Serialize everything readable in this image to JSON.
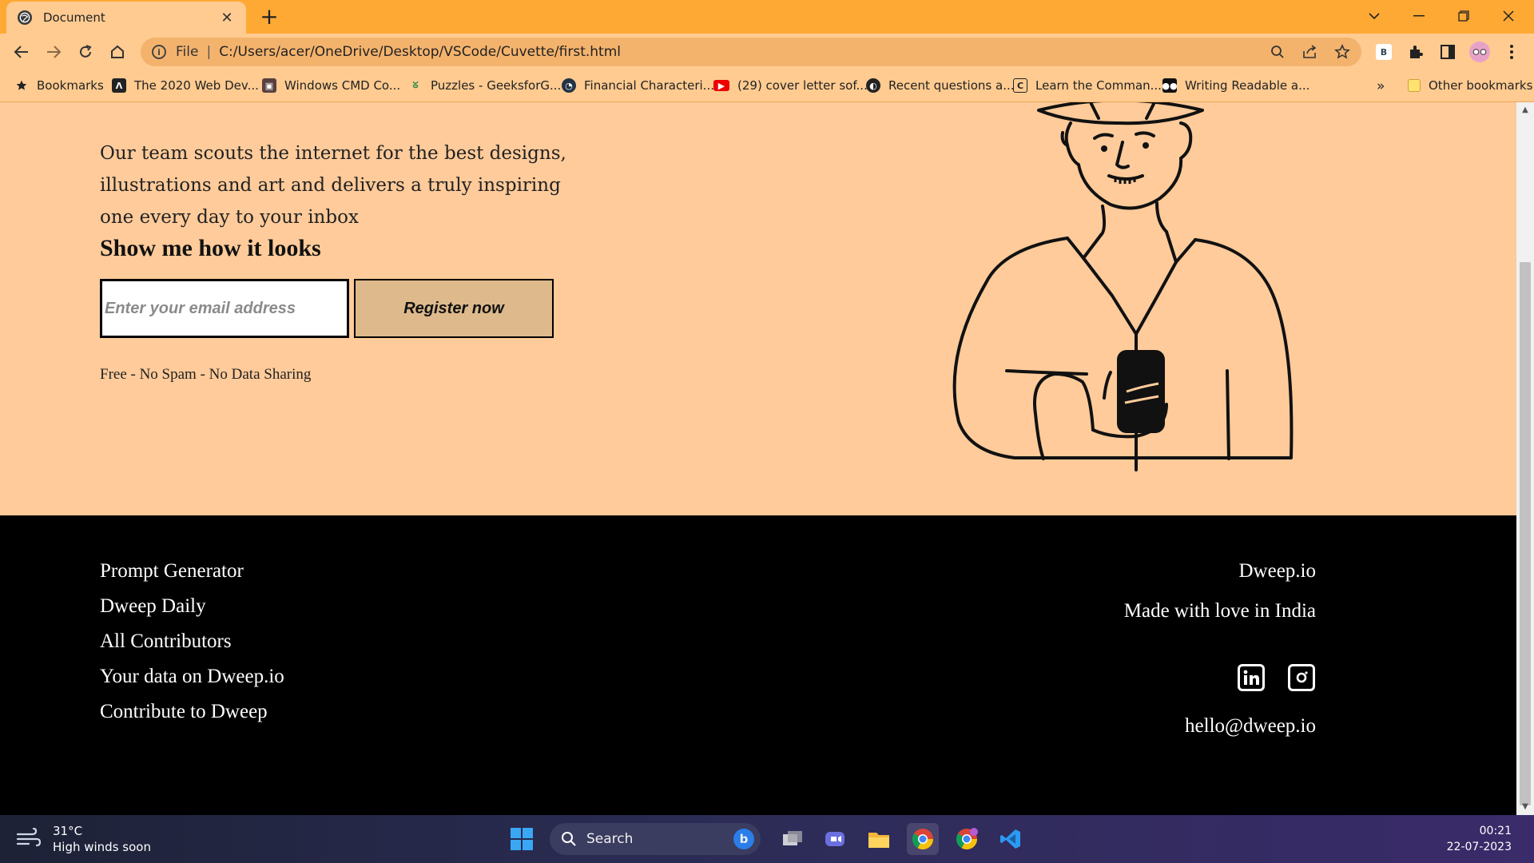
{
  "browser": {
    "tab_title": "Document",
    "tab_close": "✕",
    "new_tab": "+",
    "address_scheme": "File",
    "address_separator": "|",
    "address_url": "C:/Users/acer/OneDrive/Desktop/VSCode/Cuvette/first.html",
    "extension_badge": "B"
  },
  "bookmarks": {
    "items": [
      {
        "label": "Bookmarks",
        "icon": "star-icon"
      },
      {
        "label": "The 2020 Web Dev...",
        "icon": "udemy-icon"
      },
      {
        "label": "Windows CMD Co...",
        "icon": "cmd-icon"
      },
      {
        "label": "Puzzles - GeeksforG...",
        "icon": "geeksforgeeks-icon"
      },
      {
        "label": "Financial Characteri...",
        "icon": "site-icon"
      },
      {
        "label": "(29) cover letter sof...",
        "icon": "youtube-icon"
      },
      {
        "label": "Recent questions a...",
        "icon": "site-icon"
      },
      {
        "label": "Learn the Comman...",
        "icon": "codecademy-icon"
      },
      {
        "label": "Writing Readable a...",
        "icon": "medium-icon"
      }
    ],
    "overflow": "»",
    "other": "Other bookmarks"
  },
  "hero": {
    "description": "Our team scouts the internet for the best designs, illustrations and art and delivers a truly inspiring one every day to your inbox",
    "heading": "Show me how it looks",
    "email_placeholder": "Enter your email address",
    "register_label": "Register now",
    "note": "Free - No Spam - No Data Sharing"
  },
  "footer": {
    "links": [
      "Prompt Generator",
      "Dweep Daily",
      "All Contributors",
      "Your data on Dweep.io",
      "Contribute to Dweep"
    ],
    "brand": "Dweep.io",
    "tagline": "Made with love in India",
    "email": "hello@dweep.io",
    "socials": [
      "linkedin-icon",
      "instagram-icon"
    ]
  },
  "taskbar": {
    "temperature": "31°C",
    "forecast": "High winds soon",
    "search_label": "Search",
    "time": "00:21",
    "date": "22-07-2023"
  },
  "colors": {
    "tab_strip": "#ffa935",
    "toolbar": "#ffcb91",
    "hero_bg": "#ffcb9a",
    "register_button": "#ddb98b",
    "footer_bg": "#000000"
  }
}
